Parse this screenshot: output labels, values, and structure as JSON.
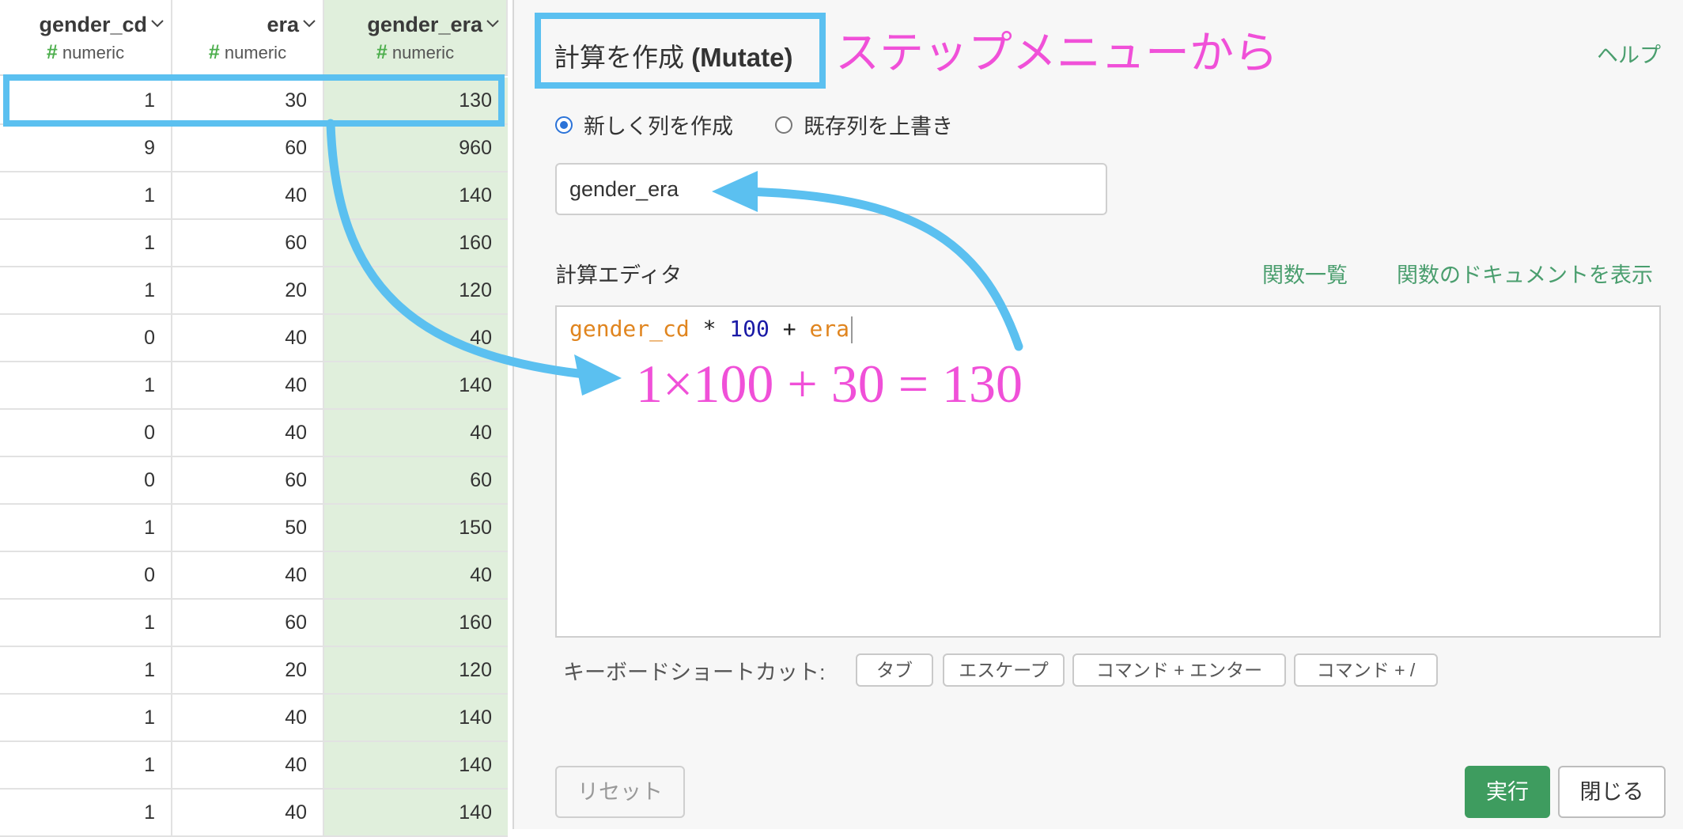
{
  "table": {
    "columns": [
      {
        "name": "gender_cd",
        "type": "numeric"
      },
      {
        "name": "era",
        "type": "numeric"
      },
      {
        "name": "gender_era",
        "type": "numeric"
      }
    ],
    "type_symbol": "#",
    "rows": [
      [
        "1",
        "30",
        "130"
      ],
      [
        "9",
        "60",
        "960"
      ],
      [
        "1",
        "40",
        "140"
      ],
      [
        "1",
        "60",
        "160"
      ],
      [
        "1",
        "20",
        "120"
      ],
      [
        "0",
        "40",
        "40"
      ],
      [
        "1",
        "40",
        "140"
      ],
      [
        "0",
        "40",
        "40"
      ],
      [
        "0",
        "60",
        "60"
      ],
      [
        "1",
        "50",
        "150"
      ],
      [
        "0",
        "40",
        "40"
      ],
      [
        "1",
        "60",
        "160"
      ],
      [
        "1",
        "20",
        "120"
      ],
      [
        "1",
        "40",
        "140"
      ],
      [
        "1",
        "40",
        "140"
      ],
      [
        "1",
        "40",
        "140"
      ]
    ]
  },
  "dialog": {
    "title_ja": "計算を作成",
    "title_en": "(Mutate)",
    "help_link": "ヘルプ",
    "radio_new": "新しく列を作成",
    "radio_overwrite": "既存列を上書き",
    "radio_selected": "new",
    "column_name_value": "gender_era",
    "editor_label": "計算エディタ",
    "functions_link": "関数一覧",
    "docs_link": "関数のドキュメントを表示",
    "code_tokens": [
      "gender_cd",
      " * ",
      "100",
      " + ",
      "era"
    ],
    "shortcuts_label": "キーボードショートカット:",
    "shortcuts": [
      "タブ",
      "エスケープ",
      "コマンド + エンター",
      "コマンド + /"
    ],
    "reset_button": "リセット",
    "run_button": "実行",
    "close_button": "閉じる"
  },
  "annotations": {
    "step_menu_note": "ステップメニューから",
    "formula_note": "1×100 + 30 = 130",
    "highlight_color": "#5bc0f0",
    "note_color": "#f050d8"
  },
  "icons": {
    "column_menu": "chevron-down-icon",
    "type_marker": "hash-icon"
  }
}
